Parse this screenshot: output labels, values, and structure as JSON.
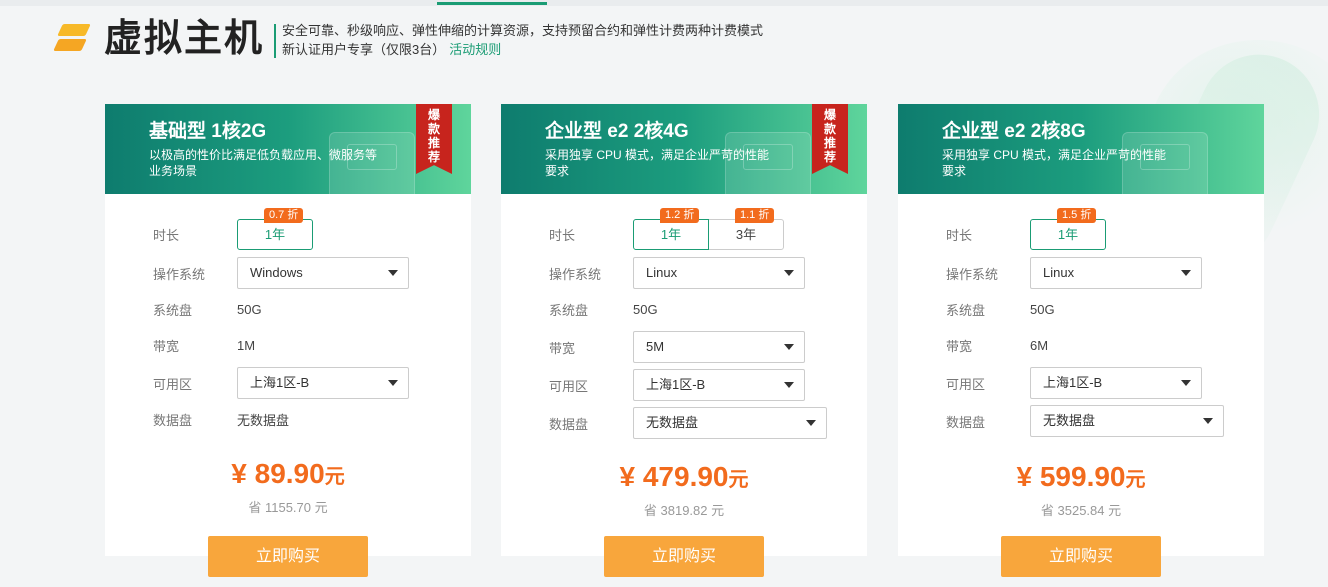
{
  "header": {
    "title": "虚拟主机",
    "line1": "安全可靠、秒级响应、弹性伸缩的计算资源，支持预留合约和弹性计费两种计费模式",
    "line2": "新认证用户专享（仅限3台）",
    "rules_link": "活动规则",
    "logo_icon": "layers-icon"
  },
  "labels": {
    "duration": "时长",
    "os": "操作系统",
    "system_disk": "系统盘",
    "bandwidth": "带宽",
    "zone": "可用区",
    "data_disk": "数据盘"
  },
  "ribbon": [
    "爆",
    "款",
    "推",
    "荐"
  ],
  "cards": [
    {
      "title": "基础型 1核2G",
      "desc": "以极高的性价比满足低负载应用、微服务等业务场景",
      "durations": [
        {
          "label": "1年",
          "discount": "0.7 折"
        }
      ],
      "os": "Windows",
      "system_disk": "50G",
      "bandwidth": "1M",
      "zone": "上海1区-B",
      "data_disk": "无数据盘",
      "price": "¥ 89.90",
      "price_unit": "元",
      "save": "省 1155.70 元",
      "buy": "立即购买"
    },
    {
      "title": "企业型 e2 2核4G",
      "desc": "采用独享 CPU 模式，满足企业严苛的性能要求",
      "durations": [
        {
          "label": "1年",
          "discount": "1.2 折"
        },
        {
          "label": "3年",
          "discount": "1.1 折"
        }
      ],
      "os": "Linux",
      "system_disk": "50G",
      "bandwidth": "5M",
      "zone": "上海1区-B",
      "data_disk": "无数据盘",
      "price": "¥ 479.90",
      "price_unit": "元",
      "save": "省 3819.82 元",
      "buy": "立即购买"
    },
    {
      "title": "企业型 e2 2核8G",
      "desc": "采用独享 CPU 模式，满足企业严苛的性能要求",
      "durations": [
        {
          "label": "1年",
          "discount": "1.5 折"
        }
      ],
      "os": "Linux",
      "system_disk": "50G",
      "bandwidth": "6M",
      "zone": "上海1区-B",
      "data_disk": "无数据盘",
      "price": "¥ 599.90",
      "price_unit": "元",
      "save": "省 3525.84 元",
      "buy": "立即购买"
    }
  ],
  "colors": {
    "accent": "#1a9c74",
    "price": "#f26b1d",
    "buy": "#f8a63c",
    "ribbon": "#c7241d"
  }
}
